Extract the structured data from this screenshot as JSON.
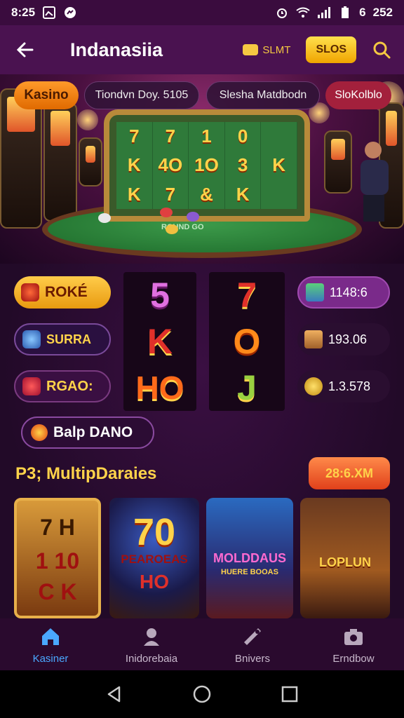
{
  "status_bar": {
    "time": "8:25",
    "battery": "6",
    "right_text": "252"
  },
  "app_bar": {
    "title": "Indanasiia",
    "coin_label": "SLMT",
    "slot_button": "SLOS"
  },
  "hero": {
    "pills": [
      "Kasino",
      "Tiondvn Doy. 5105",
      "Slesha Matdbodn",
      "SloKolblo"
    ],
    "reels": [
      [
        "7",
        "7",
        "1",
        "0",
        ""
      ],
      [
        "K",
        "4O",
        "1O",
        "3",
        "K"
      ],
      [
        "K",
        "7",
        "&",
        "K",
        ""
      ]
    ],
    "felt_text": "ROUND GO"
  },
  "left_buttons": [
    {
      "label": "ROKÉ",
      "icon": "diamond-icon"
    },
    {
      "label": "SURRA",
      "icon": "fish-icon"
    },
    {
      "label": "RGAO:",
      "icon": "gem-icon"
    }
  ],
  "center_reels": [
    {
      "symbols": [
        "5",
        "K",
        "HO"
      ],
      "colors": [
        "#e070e0",
        "#e0302a",
        "#ff6a1a"
      ]
    },
    {
      "symbols": [
        "7",
        "O",
        "J"
      ],
      "colors": [
        "#e0302a",
        "#ff8a1a",
        "#9ad040"
      ]
    }
  ],
  "right_pills": [
    {
      "value": "1148:6",
      "icon": "card-icon"
    },
    {
      "value": "193.06",
      "icon": "plane-icon"
    },
    {
      "value": "1.3.578",
      "icon": "coin-icon"
    }
  ],
  "promo": {
    "label": "Balp DANO"
  },
  "section": {
    "title": "P3; MultipDaraies",
    "action": "28:6.XM"
  },
  "games": [
    {
      "line1": "7 H",
      "line2": "1 10",
      "line3": "C K"
    },
    {
      "line1": "70",
      "line2": "PEAROEAS",
      "line3": "HO"
    },
    {
      "line1": "MOLDDAUS",
      "line2": "HUERE BOOAS",
      "line3": ""
    },
    {
      "line1": "LOPLUN",
      "line2": "",
      "line3": ""
    }
  ],
  "bottom_nav": [
    {
      "label": "Kasiner",
      "icon": "home-icon",
      "active": true
    },
    {
      "label": "Inidorebaia",
      "icon": "user-icon",
      "active": false
    },
    {
      "label": "Bnivers",
      "icon": "wrench-icon",
      "active": false
    },
    {
      "label": "Erndbow",
      "icon": "camera-icon",
      "active": false
    }
  ],
  "colors": {
    "accent": "#ffd34a",
    "active_nav": "#4aa8ff",
    "background": "#2a0a2e"
  }
}
